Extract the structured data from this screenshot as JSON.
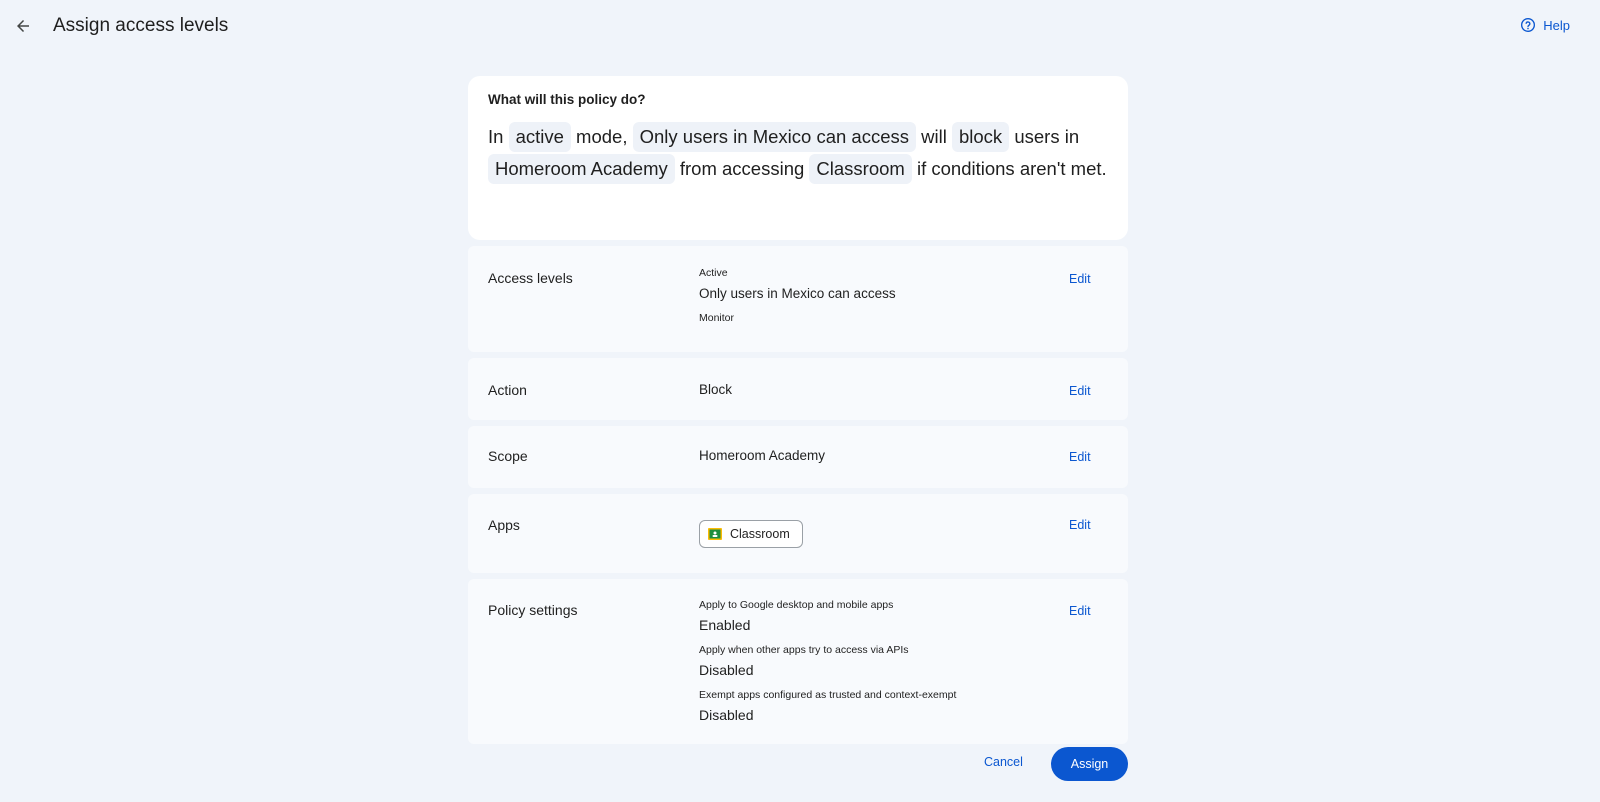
{
  "header": {
    "title": "Assign access levels",
    "back_icon": "arrow-back-icon",
    "help_label": "Help",
    "help_icon": "help-circle-icon"
  },
  "summary": {
    "question": "What will this policy do?",
    "parts": {
      "t1": "In",
      "c1": "active",
      "t2": "mode,",
      "c2": "Only users in Mexico can access",
      "t3": "will",
      "c3": "block",
      "t4": "users in",
      "c4": "Homeroom Academy",
      "t5": "from accessing",
      "c5": "Classroom",
      "t6": "if conditions aren't met."
    }
  },
  "rows": {
    "access_levels": {
      "label": "Access levels",
      "active_label": "Active",
      "active_value": "Only users in Mexico can access",
      "monitor_label": "Monitor",
      "edit": "Edit"
    },
    "action": {
      "label": "Action",
      "value": "Block",
      "edit": "Edit"
    },
    "scope": {
      "label": "Scope",
      "value": "Homeroom Academy",
      "edit": "Edit"
    },
    "apps": {
      "label": "Apps",
      "app_name": "Classroom",
      "app_icon": "classroom-icon",
      "edit": "Edit"
    },
    "policy_settings": {
      "label": "Policy settings",
      "edit": "Edit",
      "settings": [
        {
          "name": "Apply to Google desktop and mobile apps",
          "value": "Enabled"
        },
        {
          "name": "Apply when other apps try to access via APIs",
          "value": "Disabled"
        },
        {
          "name": "Exempt apps configured as trusted and context-exempt",
          "value": "Disabled"
        }
      ]
    }
  },
  "footer": {
    "cancel": "Cancel",
    "assign": "Assign"
  },
  "colors": {
    "accent": "#0b57d0",
    "background": "#f0f4fa",
    "card": "#ffffff",
    "row": "#f8fafd"
  }
}
